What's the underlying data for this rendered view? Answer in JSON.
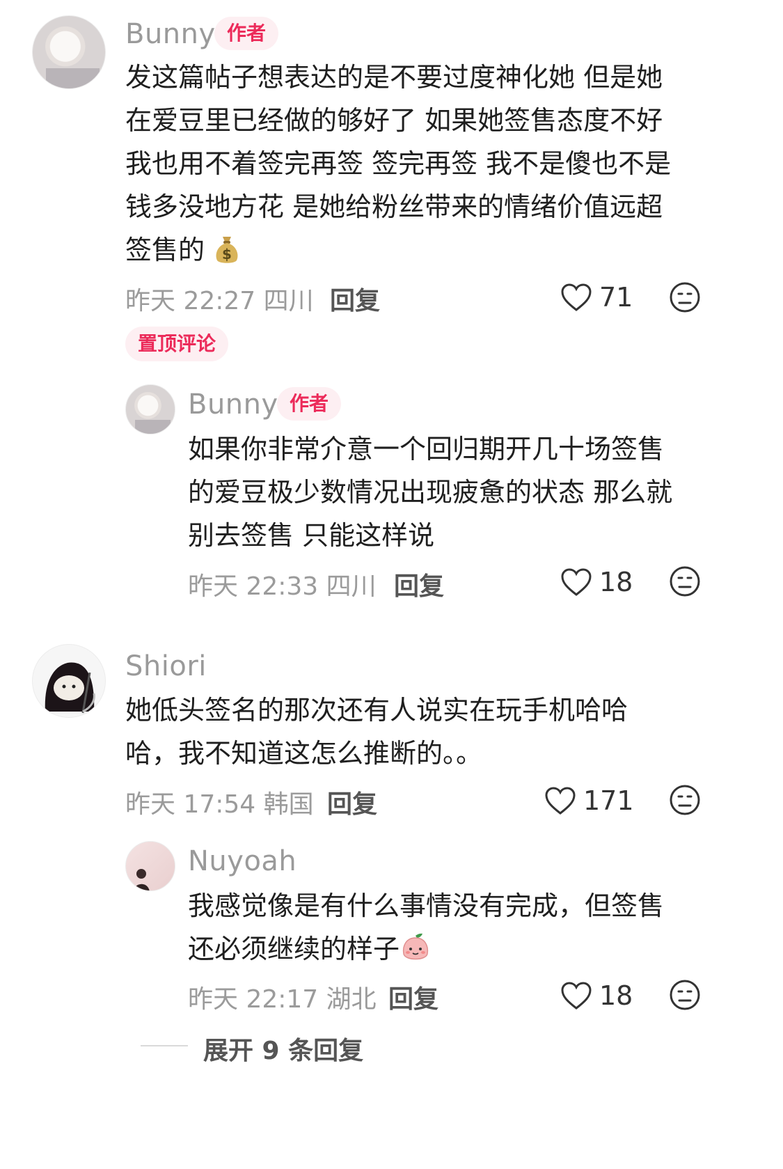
{
  "comments": [
    {
      "author": "Bunny",
      "badge": "作者",
      "text": "发这篇帖子想表达的是不要过度神化她 但是她\n在爱豆里已经做的够好了 如果她签售态度不好\n我也用不着签完再签 签完再签 我不是傻也不是\n钱多没地方花 是她给粉丝带来的情绪价值远超\n签售的",
      "emoji": "money-bag",
      "time": "昨天 22:27",
      "location": "四川",
      "reply_label": "回复",
      "likes": "71",
      "pinned_label": "置顶评论"
    },
    {
      "author": "Bunny",
      "badge": "作者",
      "text": "如果你非常介意一个回归期开几十场签售\n的爱豆极少数情况出现疲惫的状态 那么就\n别去签售 只能这样说",
      "time": "昨天 22:33",
      "location": "四川",
      "reply_label": "回复",
      "likes": "18"
    },
    {
      "author": "Shiori",
      "text": "她低头签名的那次还有人说实在玩手机哈哈\n哈，我不知道这怎么推断的。。",
      "time": "昨天 17:54",
      "location": "韩国",
      "reply_label": "回复",
      "likes": "171"
    },
    {
      "author": "Nuyoah",
      "text": "我感觉像是有什么事情没有完成，但签售\n还必须继续的样子",
      "emoji": "peach-face",
      "time": "昨天 22:17",
      "location": "湖北",
      "reply_label": "回复",
      "likes": "18"
    }
  ],
  "expand_label": "展开 9 条回复"
}
